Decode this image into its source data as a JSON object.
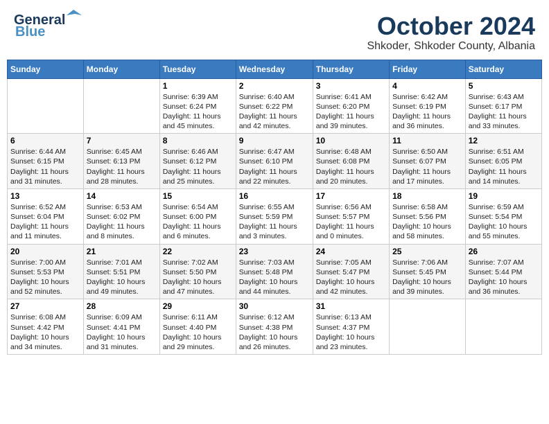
{
  "header": {
    "logo_line1": "General",
    "logo_line2": "Blue",
    "month": "October 2024",
    "location": "Shkoder, Shkoder County, Albania"
  },
  "days_of_week": [
    "Sunday",
    "Monday",
    "Tuesday",
    "Wednesday",
    "Thursday",
    "Friday",
    "Saturday"
  ],
  "weeks": [
    [
      {
        "day": "",
        "content": ""
      },
      {
        "day": "",
        "content": ""
      },
      {
        "day": "1",
        "content": "Sunrise: 6:39 AM\nSunset: 6:24 PM\nDaylight: 11 hours and 45 minutes."
      },
      {
        "day": "2",
        "content": "Sunrise: 6:40 AM\nSunset: 6:22 PM\nDaylight: 11 hours and 42 minutes."
      },
      {
        "day": "3",
        "content": "Sunrise: 6:41 AM\nSunset: 6:20 PM\nDaylight: 11 hours and 39 minutes."
      },
      {
        "day": "4",
        "content": "Sunrise: 6:42 AM\nSunset: 6:19 PM\nDaylight: 11 hours and 36 minutes."
      },
      {
        "day": "5",
        "content": "Sunrise: 6:43 AM\nSunset: 6:17 PM\nDaylight: 11 hours and 33 minutes."
      }
    ],
    [
      {
        "day": "6",
        "content": "Sunrise: 6:44 AM\nSunset: 6:15 PM\nDaylight: 11 hours and 31 minutes."
      },
      {
        "day": "7",
        "content": "Sunrise: 6:45 AM\nSunset: 6:13 PM\nDaylight: 11 hours and 28 minutes."
      },
      {
        "day": "8",
        "content": "Sunrise: 6:46 AM\nSunset: 6:12 PM\nDaylight: 11 hours and 25 minutes."
      },
      {
        "day": "9",
        "content": "Sunrise: 6:47 AM\nSunset: 6:10 PM\nDaylight: 11 hours and 22 minutes."
      },
      {
        "day": "10",
        "content": "Sunrise: 6:48 AM\nSunset: 6:08 PM\nDaylight: 11 hours and 20 minutes."
      },
      {
        "day": "11",
        "content": "Sunrise: 6:50 AM\nSunset: 6:07 PM\nDaylight: 11 hours and 17 minutes."
      },
      {
        "day": "12",
        "content": "Sunrise: 6:51 AM\nSunset: 6:05 PM\nDaylight: 11 hours and 14 minutes."
      }
    ],
    [
      {
        "day": "13",
        "content": "Sunrise: 6:52 AM\nSunset: 6:04 PM\nDaylight: 11 hours and 11 minutes."
      },
      {
        "day": "14",
        "content": "Sunrise: 6:53 AM\nSunset: 6:02 PM\nDaylight: 11 hours and 8 minutes."
      },
      {
        "day": "15",
        "content": "Sunrise: 6:54 AM\nSunset: 6:00 PM\nDaylight: 11 hours and 6 minutes."
      },
      {
        "day": "16",
        "content": "Sunrise: 6:55 AM\nSunset: 5:59 PM\nDaylight: 11 hours and 3 minutes."
      },
      {
        "day": "17",
        "content": "Sunrise: 6:56 AM\nSunset: 5:57 PM\nDaylight: 11 hours and 0 minutes."
      },
      {
        "day": "18",
        "content": "Sunrise: 6:58 AM\nSunset: 5:56 PM\nDaylight: 10 hours and 58 minutes."
      },
      {
        "day": "19",
        "content": "Sunrise: 6:59 AM\nSunset: 5:54 PM\nDaylight: 10 hours and 55 minutes."
      }
    ],
    [
      {
        "day": "20",
        "content": "Sunrise: 7:00 AM\nSunset: 5:53 PM\nDaylight: 10 hours and 52 minutes."
      },
      {
        "day": "21",
        "content": "Sunrise: 7:01 AM\nSunset: 5:51 PM\nDaylight: 10 hours and 49 minutes."
      },
      {
        "day": "22",
        "content": "Sunrise: 7:02 AM\nSunset: 5:50 PM\nDaylight: 10 hours and 47 minutes."
      },
      {
        "day": "23",
        "content": "Sunrise: 7:03 AM\nSunset: 5:48 PM\nDaylight: 10 hours and 44 minutes."
      },
      {
        "day": "24",
        "content": "Sunrise: 7:05 AM\nSunset: 5:47 PM\nDaylight: 10 hours and 42 minutes."
      },
      {
        "day": "25",
        "content": "Sunrise: 7:06 AM\nSunset: 5:45 PM\nDaylight: 10 hours and 39 minutes."
      },
      {
        "day": "26",
        "content": "Sunrise: 7:07 AM\nSunset: 5:44 PM\nDaylight: 10 hours and 36 minutes."
      }
    ],
    [
      {
        "day": "27",
        "content": "Sunrise: 6:08 AM\nSunset: 4:42 PM\nDaylight: 10 hours and 34 minutes."
      },
      {
        "day": "28",
        "content": "Sunrise: 6:09 AM\nSunset: 4:41 PM\nDaylight: 10 hours and 31 minutes."
      },
      {
        "day": "29",
        "content": "Sunrise: 6:11 AM\nSunset: 4:40 PM\nDaylight: 10 hours and 29 minutes."
      },
      {
        "day": "30",
        "content": "Sunrise: 6:12 AM\nSunset: 4:38 PM\nDaylight: 10 hours and 26 minutes."
      },
      {
        "day": "31",
        "content": "Sunrise: 6:13 AM\nSunset: 4:37 PM\nDaylight: 10 hours and 23 minutes."
      },
      {
        "day": "",
        "content": ""
      },
      {
        "day": "",
        "content": ""
      }
    ]
  ]
}
